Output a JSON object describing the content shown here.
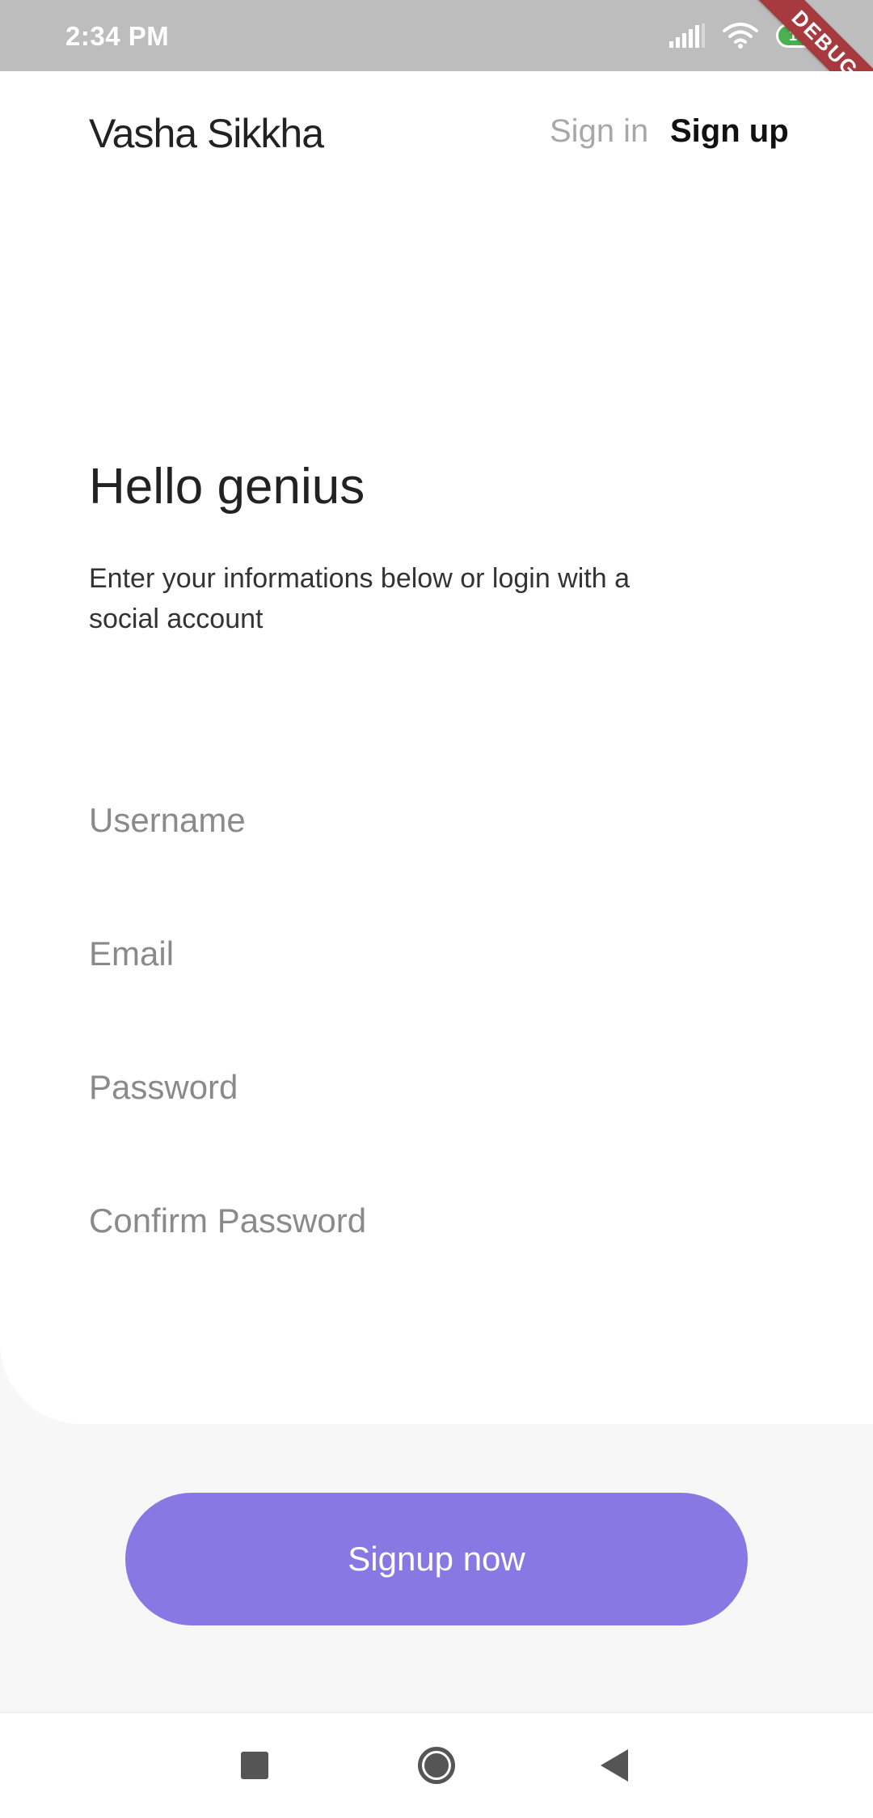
{
  "status_bar": {
    "time": "2:34 PM",
    "battery": "100",
    "debug_label": "DEBUG",
    "icons": [
      "signal-icon",
      "wifi-icon",
      "battery-icon"
    ]
  },
  "header": {
    "logo": "Vasha Sikkha",
    "tabs": {
      "sign_in": "Sign in",
      "sign_up": "Sign up"
    }
  },
  "main": {
    "title": "Hello genius",
    "subtitle": "Enter your informations below or login with a social account",
    "fields": {
      "username_placeholder": "Username",
      "email_placeholder": "Email",
      "password_placeholder": "Password",
      "confirm_password_placeholder": "Confirm Password"
    }
  },
  "cta": {
    "label": "Signup now",
    "color": "#8878e3"
  },
  "nav": {
    "icons": [
      "recents-icon",
      "home-icon",
      "back-icon"
    ]
  }
}
